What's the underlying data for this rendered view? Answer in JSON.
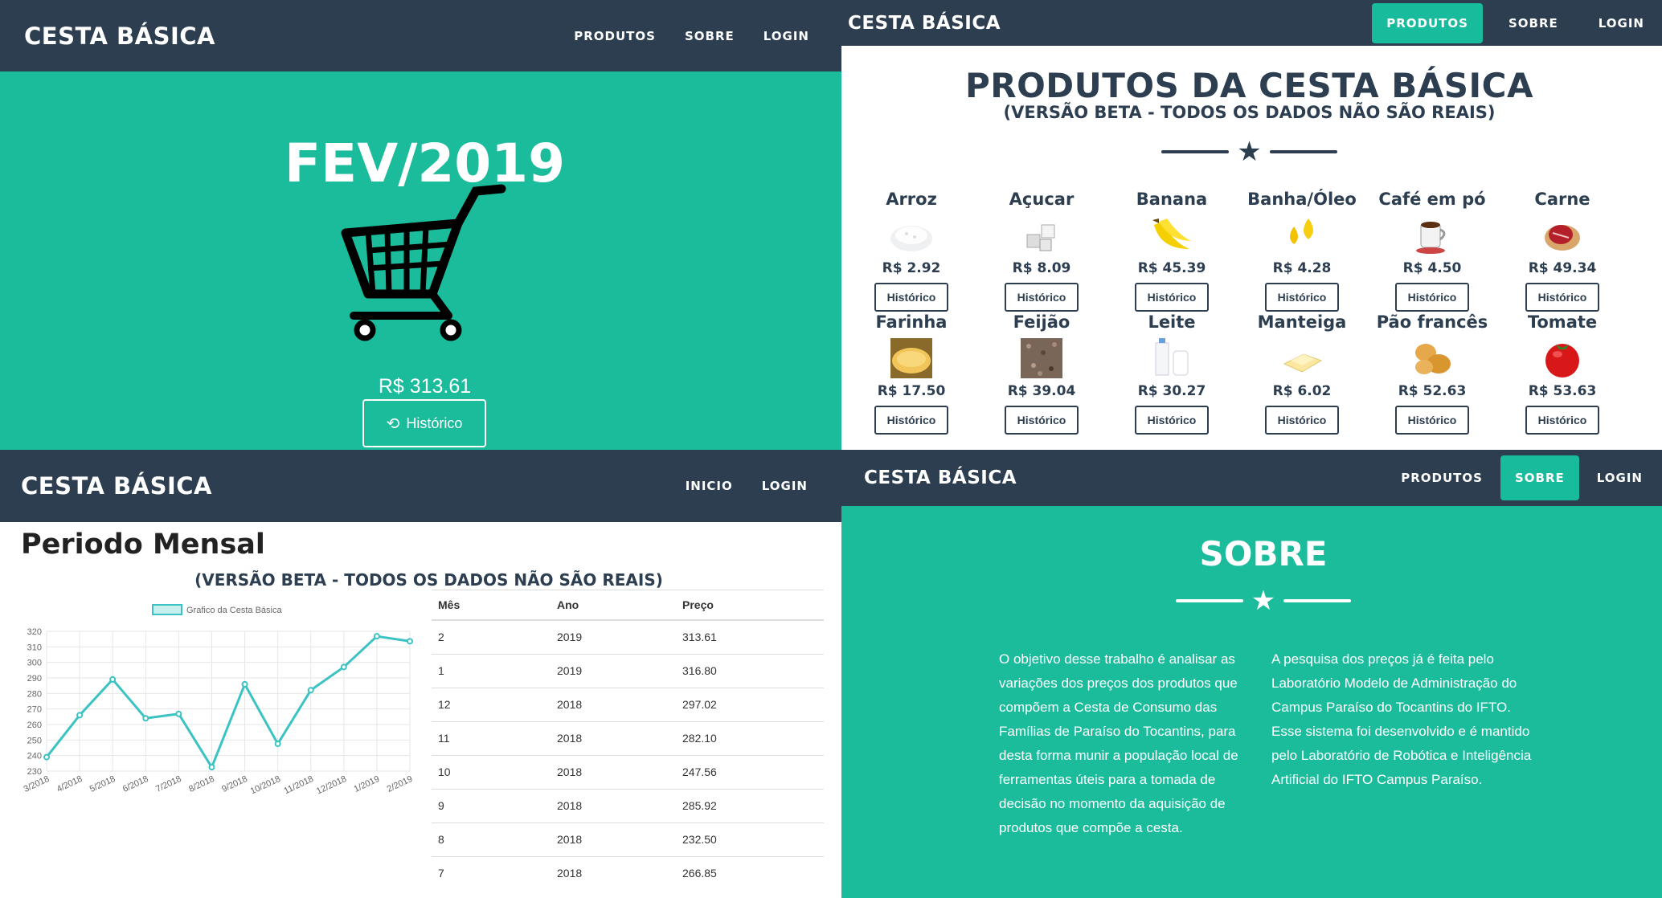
{
  "home": {
    "brand": "CESTA BÁSICA",
    "nav": [
      "PRODUTOS",
      "SOBRE",
      "LOGIN"
    ],
    "month_title": "FEV/2019",
    "total": "R$ 313.61",
    "history_button": "Histórico"
  },
  "produtos": {
    "brand": "CESTA BÁSICA",
    "nav": [
      "PRODUTOS",
      "SOBRE",
      "LOGIN"
    ],
    "title": "PRODUTOS DA CESTA BÁSICA",
    "subtitle": "(VERSÃO BETA - TODOS OS DADOS NÃO SÃO REAIS)",
    "history_button": "Histórico",
    "items": [
      {
        "name": "Arroz",
        "price": "R$ 2.92",
        "icon": "rice-icon"
      },
      {
        "name": "Açucar",
        "price": "R$ 8.09",
        "icon": "sugar-icon"
      },
      {
        "name": "Banana",
        "price": "R$ 45.39",
        "icon": "banana-icon"
      },
      {
        "name": "Banha/Óleo",
        "price": "R$ 4.28",
        "icon": "oil-icon"
      },
      {
        "name": "Café em pó",
        "price": "R$ 4.50",
        "icon": "coffee-icon"
      },
      {
        "name": "Carne",
        "price": "R$ 49.34",
        "icon": "meat-icon"
      },
      {
        "name": "Farinha",
        "price": "R$ 17.50",
        "icon": "flour-icon"
      },
      {
        "name": "Feijão",
        "price": "R$ 39.04",
        "icon": "beans-icon"
      },
      {
        "name": "Leite",
        "price": "R$ 30.27",
        "icon": "milk-icon"
      },
      {
        "name": "Manteiga",
        "price": "R$ 6.02",
        "icon": "butter-icon"
      },
      {
        "name": "Pão francês",
        "price": "R$ 52.63",
        "icon": "bread-icon"
      },
      {
        "name": "Tomate",
        "price": "R$ 53.63",
        "icon": "tomato-icon"
      }
    ]
  },
  "periodo": {
    "brand": "CESTA BÁSICA",
    "nav": [
      "INICIO",
      "LOGIN"
    ],
    "title": "Periodo Mensal",
    "subtitle": "(VERSÃO BETA - TODOS OS DADOS NÃO SÃO REAIS)",
    "table": {
      "headers": [
        "Mês",
        "Ano",
        "Preço"
      ],
      "rows": [
        [
          "2",
          "2019",
          "313.61"
        ],
        [
          "1",
          "2019",
          "316.80"
        ],
        [
          "12",
          "2018",
          "297.02"
        ],
        [
          "11",
          "2018",
          "282.10"
        ],
        [
          "10",
          "2018",
          "247.56"
        ],
        [
          "9",
          "2018",
          "285.92"
        ],
        [
          "8",
          "2018",
          "232.50"
        ],
        [
          "7",
          "2018",
          "266.85"
        ]
      ]
    }
  },
  "chart_data": {
    "type": "line",
    "title": "",
    "xlabel": "",
    "ylabel": "",
    "x": [
      "3/2018",
      "4/2018",
      "5/2018",
      "6/2018",
      "7/2018",
      "8/2018",
      "9/2018",
      "10/2018",
      "11/2018",
      "12/2018",
      "1/2019",
      "2/2019"
    ],
    "series": [
      {
        "name": "Grafico da Cesta Básica",
        "values": [
          239,
          266,
          289,
          264,
          266.85,
          232.5,
          285.92,
          247.56,
          282.1,
          297.02,
          316.8,
          313.61
        ]
      }
    ],
    "yticks": [
      230,
      240,
      250,
      260,
      270,
      280,
      290,
      300,
      310,
      320
    ],
    "ylim": [
      230,
      320
    ],
    "grid": true,
    "legend": "top",
    "color": "#3bc3c3"
  },
  "sobre": {
    "brand": "CESTA BÁSICA",
    "nav": [
      "PRODUTOS",
      "SOBRE",
      "LOGIN"
    ],
    "title": "SOBRE",
    "paragraph_left": "O objetivo desse trabalho é analisar as variações dos preços dos produtos que compõem a Cesta de Consumo das Famílias de Paraíso do Tocantins, para desta forma munir a população local de ferramentas úteis para a tomada de decisão no momento da aquisição de produtos que compõe a cesta.",
    "paragraph_right": "A pesquisa dos preços já é feita pelo Laboratório Modelo de Administração do Campus Paraíso do Tocantins do IFTO. Esse sistema foi desenvolvido e é mantido pelo Laboratório de Robótica e Inteligência Artificial do IFTO Campus Paraíso."
  },
  "colors": {
    "navy": "#2c3e50",
    "teal": "#1abc9c",
    "active_tab": "#18bc9c"
  }
}
